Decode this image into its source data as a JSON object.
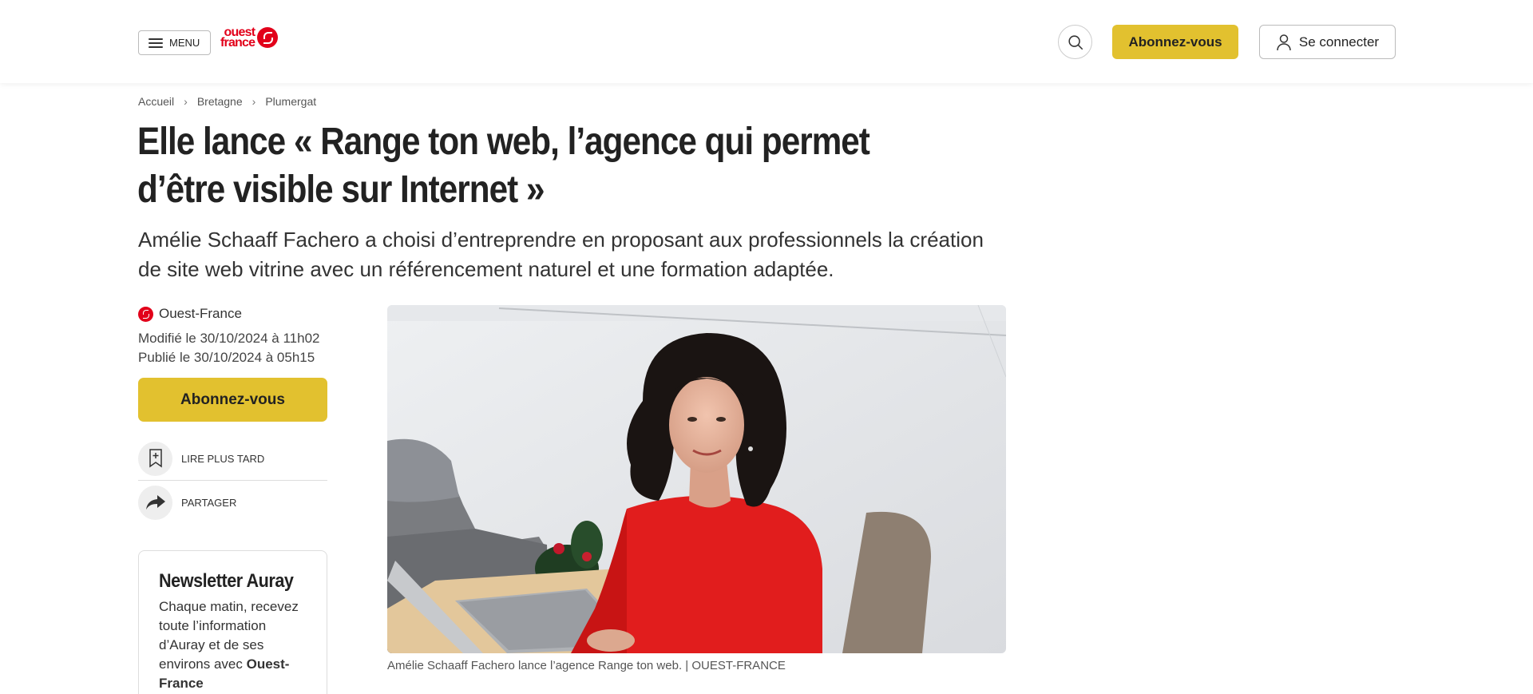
{
  "header": {
    "menu_label": "MENU",
    "logo_line1": "ouest",
    "logo_line2": "france",
    "subscribe_label": "Abonnez-vous",
    "login_label": "Se connecter"
  },
  "breadcrumb": [
    "Accueil",
    "Bretagne",
    "Plumergat"
  ],
  "article": {
    "title": "Elle lance « Range ton web, l’agence qui permet d’être visible sur Internet »",
    "lede": "Amélie Schaaff Fachero a choisi d’entreprendre en proposant aux professionnels la création de site web vitrine avec un référencement naturel et une formation adaptée.",
    "source": "Ouest-France",
    "modified": "Modifié le 30/10/2024 à 11h02",
    "published": "Publié le 30/10/2024 à 05h15",
    "subscribe_label": "Abonnez-vous",
    "read_later_label": "LIRE PLUS TARD",
    "share_label": "PARTAGER",
    "image_caption": "Amélie Schaaff Fachero lance l’agence Range ton web. | OUEST-FRANCE"
  },
  "newsletter": {
    "title": "Newsletter Auray",
    "text": "Chaque matin, recevez toute l’information d’Auray et de ses environs avec ",
    "brand": "Ouest-France"
  },
  "colors": {
    "brand_red": "#e2001a",
    "subscribe_yellow": "#e2c12f"
  },
  "icons": {
    "search": "search-icon",
    "user": "user-icon",
    "bookmark": "bookmark-add-icon",
    "share": "share-arrow-icon",
    "menu": "hamburger-icon"
  }
}
